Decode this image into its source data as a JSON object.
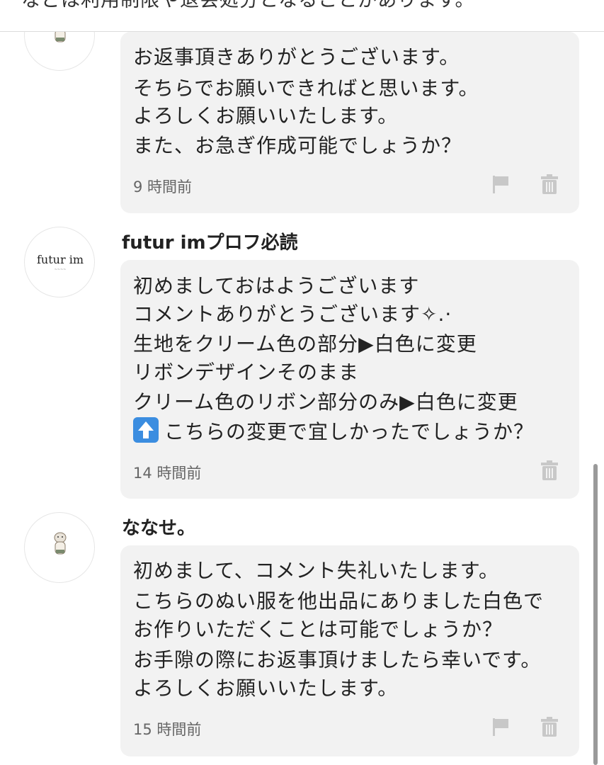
{
  "top_notice": "などは利用制限や退会処分となることがあります。",
  "comments": [
    {
      "username": "",
      "lines": [
        "お返事頂きありがとうございます。",
        "そちらでお願いできればと思います。",
        "よろしくお願いいたします。",
        "また、お急ぎ作成可能でしょうか？"
      ],
      "time": "9 時間前"
    },
    {
      "username": "futur imプロフ必読",
      "avatar_logo": "futur im",
      "lines": [
        "初めましておはようございます",
        "コメントありがとうございます✧.·",
        "生地をクリーム色の部分▶白色に変更",
        "リボンデザインそのまま",
        "クリーム色のリボン部分のみ▶白色に変更",
        "こちらの変更で宜しかったでしょうか？"
      ],
      "line6_emoji": "up-arrow-emoji",
      "time": "14 時間前"
    },
    {
      "username": "ななせ。",
      "lines": [
        "初めまして、コメント失礼いたします。",
        "こちらのぬい服を他出品にありました白色で",
        "お作りいただくことは可能でしょうか？",
        "お手隙の際にお返事頂けましたら幸いです。",
        "よろしくお願いいたします。"
      ],
      "time": "15 時間前"
    }
  ],
  "icons": {
    "flag": "flag-icon",
    "trash": "trash-icon"
  },
  "colors": {
    "bubble": "#f2f2f2",
    "icon": "#c8c8c8",
    "emoji_blue": "#3b8de0"
  }
}
